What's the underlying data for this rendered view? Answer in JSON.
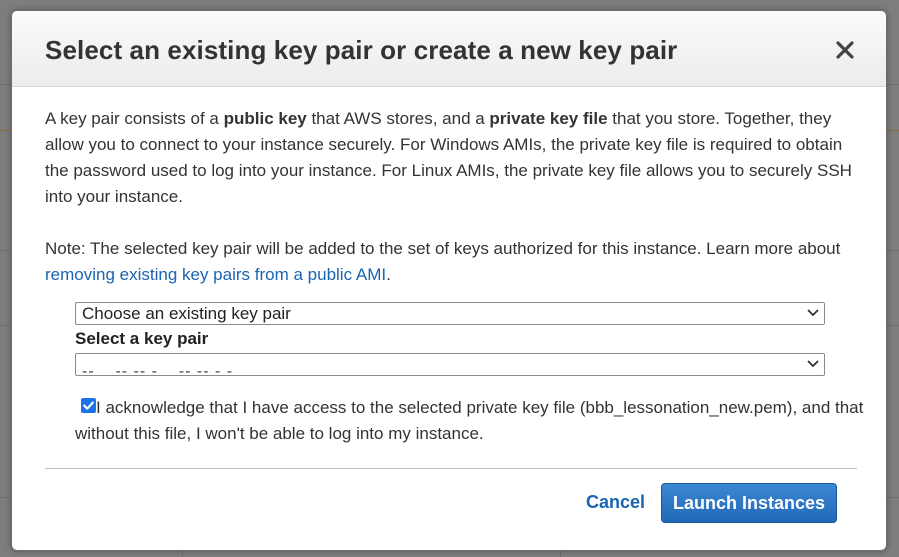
{
  "modal": {
    "title": "Select an existing key pair or create a new key pair",
    "intro": {
      "t1": "A key pair consists of a ",
      "b1": "public key",
      "t2": " that AWS stores, and a ",
      "b2": "private key file",
      "t3": " that you store. Together, they allow you to connect to your instance securely. For Windows AMIs, the private key file is required to obtain the password used to log into your instance. For Linux AMIs, the private key file allows you to securely SSH into your instance."
    },
    "note": {
      "text": "Note: The selected key pair will be added to the set of keys authorized for this instance. Learn more about ",
      "link": "removing existing key pairs from a public AMI",
      "end": "."
    },
    "key_pair_mode": {
      "selected": "Choose an existing key pair"
    },
    "select_label": "Select a key pair",
    "key_pair_select": {
      "selected": "-- _ -- -- - _ -- -- - -"
    },
    "acknowledge": {
      "checked": true,
      "text": "I acknowledge that I have access to the selected private key file (bbb_lessonation_new.pem), and that without this file, I won't be able to log into my instance."
    },
    "buttons": {
      "cancel": "Cancel",
      "launch": "Launch Instances"
    }
  },
  "colors": {
    "accent": "#1a64b4",
    "primary_button": "#2069b8",
    "overlay": "#7d7d7d"
  }
}
